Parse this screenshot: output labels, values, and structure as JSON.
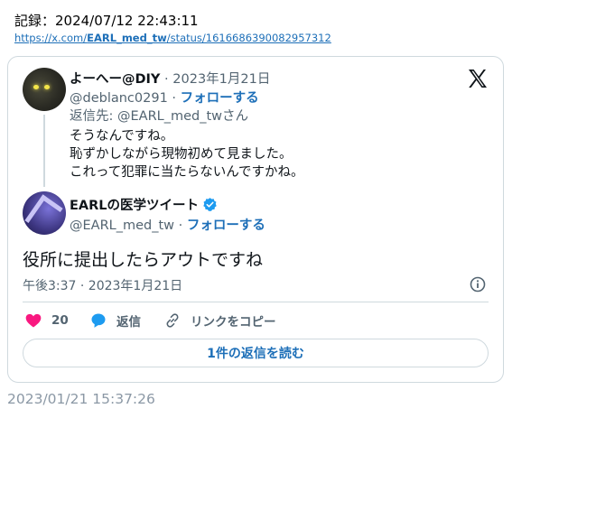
{
  "record": "記録：2024/07/12 22:43:11",
  "url": {
    "prefix": "https://x.com/",
    "handle": "EARL_med_tw",
    "suffix": "/status/1616686390082957312"
  },
  "reply": {
    "display_name": "よーへー@DIY",
    "date": " · 2023年1月21日",
    "handle": "@deblanc0291 · ",
    "follow": "フォローする",
    "replying_to": "返信先: @EARL_med_twさん",
    "lines": [
      "そうなんですね。",
      "恥ずかしながら現物初めて見ました。",
      "これって犯罪に当たらないんですかね。"
    ]
  },
  "main": {
    "display_name": "EARLの医学ツイート",
    "handle": "@EARL_med_tw · ",
    "follow": "フォローする",
    "text": "役所に提出したらアウトですね",
    "meta": "午後3:37 · 2023年1月21日"
  },
  "actions": {
    "likes": "20",
    "reply_label": "返信",
    "copy_label": "リンクをコピー"
  },
  "read_replies": "1件の返信を読む",
  "timestamp": "2023/01/21 15:37:26",
  "icons": [
    "heart-icon",
    "reply-bubble-icon",
    "link-icon",
    "info-icon",
    "x-logo-icon",
    "verified-badge-icon"
  ],
  "colors": {
    "accent": "#1d9bf0",
    "like": "#f91880",
    "muted": "#536471",
    "border": "#cfd9de"
  }
}
